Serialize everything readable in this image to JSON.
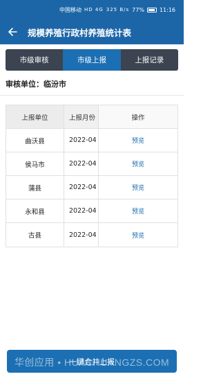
{
  "status_bar": {
    "carrier": "中国移动",
    "network": "HD 4G",
    "speed": "325 B/s",
    "battery": "77%",
    "time": "11:16"
  },
  "header": {
    "back_icon": "arrow-left-icon",
    "title": "规模养殖行政村养殖统计表"
  },
  "tabs": [
    {
      "label": "市级审核",
      "active": false
    },
    {
      "label": "市级上报",
      "active": true
    },
    {
      "label": "上报记录",
      "active": false
    }
  ],
  "unit": {
    "label": "审核单位：",
    "value": "临汾市"
  },
  "table": {
    "columns": [
      "上报单位",
      "上报月份",
      "操作"
    ],
    "rows": [
      {
        "unit": "曲沃县",
        "month": "2022-04",
        "action": "预览"
      },
      {
        "unit": "侯马市",
        "month": "2022-04",
        "action": "预览"
      },
      {
        "unit": "蒲县",
        "month": "2022-04",
        "action": "预览"
      },
      {
        "unit": "永和县",
        "month": "2022-04",
        "action": "预览"
      },
      {
        "unit": "古县",
        "month": "2022-04",
        "action": "预览"
      }
    ]
  },
  "footer": {
    "merge_button": "一键合并上报",
    "watermark": "华创应用 • HUACHUANGZS.COM"
  },
  "colors": {
    "primary": "#1c66a8",
    "tab_bg": "#3b4450",
    "tab_active": "#1c6fb3",
    "link": "#1c6fb3"
  }
}
